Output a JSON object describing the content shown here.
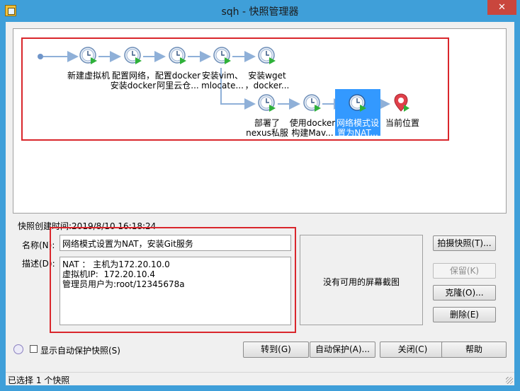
{
  "window": {
    "title": "sqh - 快照管理器",
    "close_label": "✕"
  },
  "tree": {
    "nodes": [
      {
        "id": "n1",
        "label1": "新建虚拟机",
        "label2": ""
      },
      {
        "id": "n2",
        "label1": "配置网络，",
        "label2": "安装docker"
      },
      {
        "id": "n3",
        "label1": "配置docker",
        "label2": "阿里云仓..."
      },
      {
        "id": "n4",
        "label1": "安装vim、",
        "label2": "mlocate..."
      },
      {
        "id": "n5",
        "label1": "安装wget",
        "label2": "，docker..."
      },
      {
        "id": "n6",
        "label1": "部署了",
        "label2": "nexus私服"
      },
      {
        "id": "n7",
        "label1": "使用docker",
        "label2": "构建Mav..."
      },
      {
        "id": "n8",
        "label1": "网络模式设",
        "label2": "置为NAT..."
      },
      {
        "id": "n9",
        "label1": "当前位置",
        "label2": ""
      }
    ]
  },
  "details": {
    "created_label": "快照创建时间:",
    "created_value": "2019/8/10 16:18:24",
    "name_label": "名称(N):",
    "name_value": "网络模式设置为NAT，安装Git服务",
    "desc_label": "描述(D):",
    "desc_value": "NAT ： 主机为172.20.10.0\n虚拟机IP:  172.20.10.4\n管理员用户为:root/12345678a",
    "preview_text": "没有可用的屏幕截图"
  },
  "side_buttons": {
    "take": "拍摄快照(T)...",
    "keep": "保留(K)",
    "clone": "克隆(O)...",
    "delete": "删除(E)"
  },
  "bottom": {
    "autoprotect_check_label": "显示自动保护快照(S)",
    "goto": "转到(G)",
    "autoprotect": "自动保护(A)...",
    "close": "关闭(C)",
    "help": "帮助"
  },
  "status": {
    "text": "已选择 1 个快照"
  },
  "colors": {
    "accent": "#3399ff",
    "titlebar": "#3f9fd9",
    "highlight_box": "#d9262c",
    "close": "#c9463d"
  }
}
